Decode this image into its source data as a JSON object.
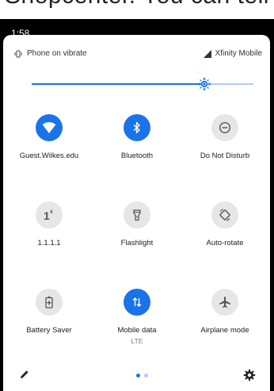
{
  "top_crop": {
    "text": "Shopcenter. You can tell that"
  },
  "status_bar": {
    "time": "1:58"
  },
  "header": {
    "ringer_label": "Phone on vibrate",
    "carrier_label": "Xfinity Mobile",
    "ringer_icon": "vibrate-icon",
    "carrier_icon": "signal-icon"
  },
  "brightness": {
    "level": 0.78,
    "accent": "#1a73e8",
    "track_light": "#aecbfa"
  },
  "tiles": [
    {
      "label": "Guest.Wilkes.edu",
      "icon": "wifi-icon",
      "on": true
    },
    {
      "label": "Bluetooth",
      "icon": "bluetooth-icon",
      "on": true
    },
    {
      "label": "Do Not Disturb",
      "icon": "do-not-disturb-icon",
      "on": false
    },
    {
      "label": "1.1.1.1",
      "icon": "warp-icon",
      "on": false
    },
    {
      "label": "Flashlight",
      "icon": "flashlight-icon",
      "on": false
    },
    {
      "label": "Auto-rotate",
      "icon": "auto-rotate-icon",
      "on": false
    },
    {
      "label": "Battery Saver",
      "icon": "battery-saver-icon",
      "on": false
    },
    {
      "label": "Mobile data",
      "sublabel": "LTE",
      "icon": "mobile-data-icon",
      "on": true
    },
    {
      "label": "Airplane mode",
      "icon": "airplane-icon",
      "on": false
    }
  ],
  "footer": {
    "edit_icon": "pencil-icon",
    "settings_icon": "gear-icon",
    "pages": 2,
    "active_page": 1
  }
}
